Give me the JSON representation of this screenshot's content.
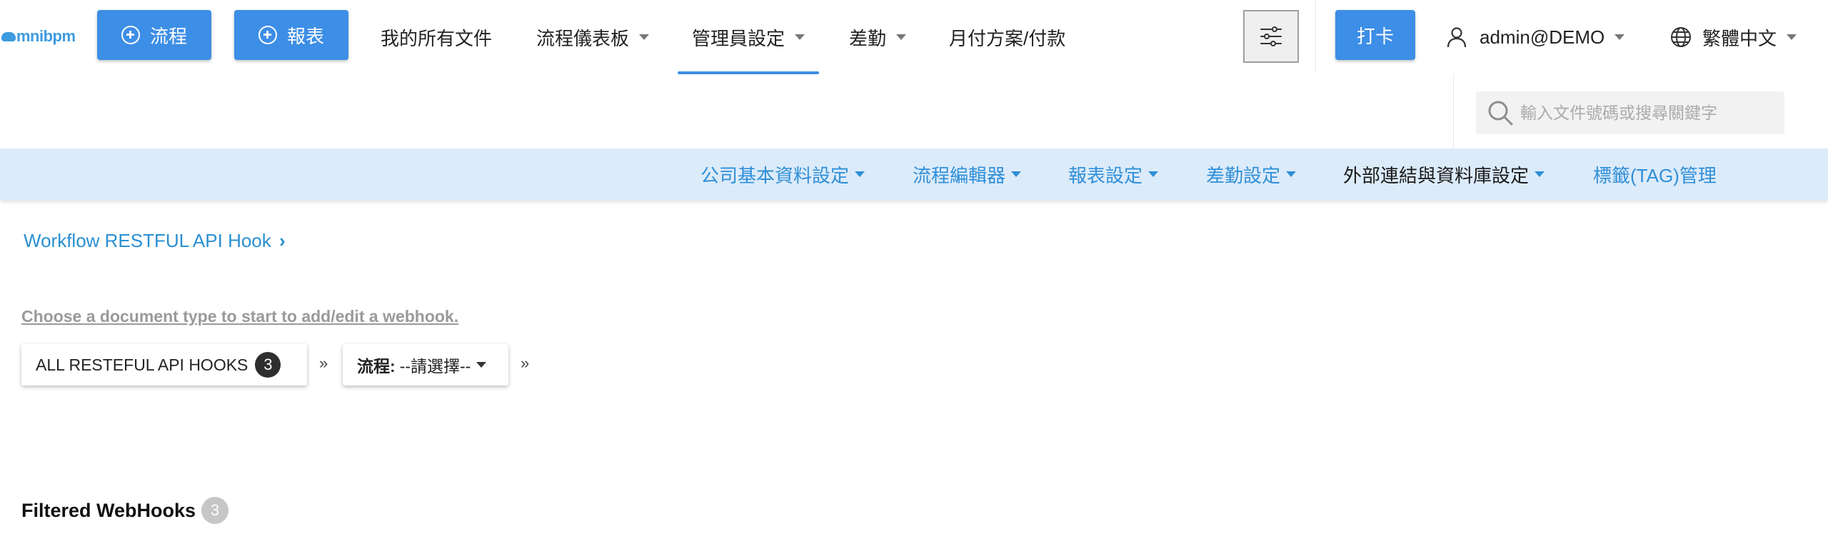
{
  "brand": {
    "logo_text": "mnibpm",
    "accent_color": "#3d8ee6"
  },
  "topnav": {
    "process_button": "流程",
    "report_button": "報表",
    "items": [
      {
        "label": "我的所有文件",
        "has_dropdown": false
      },
      {
        "label": "流程儀表板",
        "has_dropdown": true
      },
      {
        "label": "管理員設定",
        "has_dropdown": true,
        "active": true
      },
      {
        "label": "差勤",
        "has_dropdown": true
      },
      {
        "label": "月付方案/付款",
        "has_dropdown": false
      }
    ],
    "filter_icon": "sliders-icon",
    "punch_button": "打卡",
    "user": "admin@DEMO",
    "language": "繁體中文"
  },
  "search": {
    "placeholder": "輸入文件號碼或搜尋關鍵字"
  },
  "subnav": {
    "items": [
      {
        "label": "公司基本資料設定",
        "has_dropdown": true
      },
      {
        "label": "流程編輯器",
        "has_dropdown": true
      },
      {
        "label": "報表設定",
        "has_dropdown": true
      },
      {
        "label": "差勤設定",
        "has_dropdown": true
      },
      {
        "label": "外部連結與資料庫設定",
        "has_dropdown": true,
        "active": true
      },
      {
        "label": "標籤(TAG)管理",
        "has_dropdown": false
      }
    ]
  },
  "breadcrumb": {
    "label": "Workflow RESTFUL API Hook",
    "chevron": "›"
  },
  "hint": "Choose a document type to start to add/edit a webhook.",
  "filter_chips": {
    "all_hooks_label": "ALL RESTEFUL API HOOKS",
    "all_hooks_count": "3",
    "separator": "»",
    "process_prefix": "流程:",
    "process_value": "--請選擇--"
  },
  "filtered": {
    "title": "Filtered WebHooks",
    "count": "3"
  }
}
